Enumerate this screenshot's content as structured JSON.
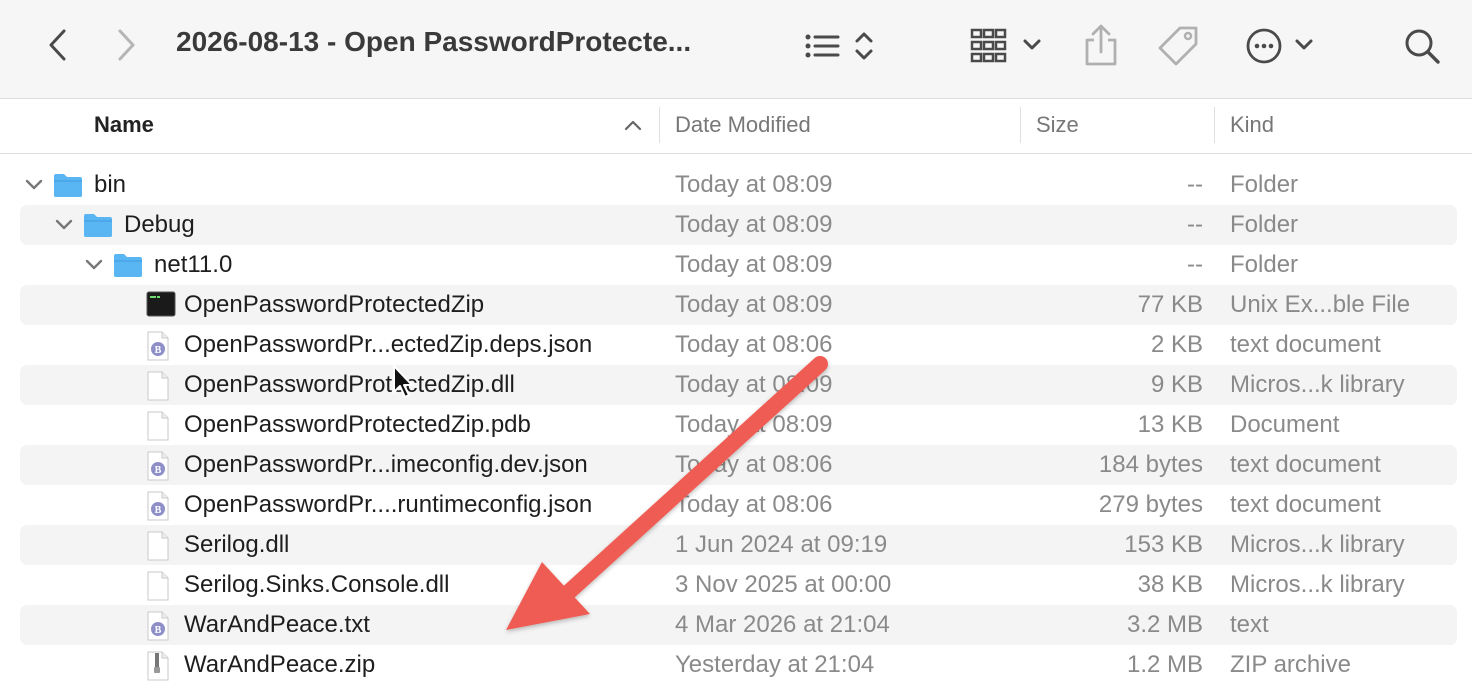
{
  "window": {
    "title": "2026-08-13 - Open PasswordProtecte..."
  },
  "colors": {
    "folder": "#5ab6f2",
    "arrow": "#ef5b52",
    "zebra": "#f4f4f4"
  },
  "columns": {
    "name": "Name",
    "date": "Date Modified",
    "size": "Size",
    "kind": "Kind"
  },
  "rows": [
    {
      "name": "bin",
      "date": "Today at 08:09",
      "size": "--",
      "kind": "Folder",
      "depth": 0,
      "icon": "folder-icon"
    },
    {
      "name": "Debug",
      "date": "Today at 08:09",
      "size": "--",
      "kind": "Folder",
      "depth": 1,
      "icon": "folder-icon"
    },
    {
      "name": "net11.0",
      "date": "Today at 08:09",
      "size": "--",
      "kind": "Folder",
      "depth": 2,
      "icon": "folder-icon"
    },
    {
      "name": "OpenPasswordProtectedZip",
      "date": "Today at 08:09",
      "size": "77 KB",
      "kind": "Unix Ex...ble File",
      "depth": 3,
      "icon": "terminal-icon"
    },
    {
      "name": "OpenPasswordPr...ectedZip.deps.json",
      "date": "Today at 08:06",
      "size": "2 KB",
      "kind": "text document",
      "depth": 3,
      "icon": "text-document-icon"
    },
    {
      "name": "OpenPasswordProtectedZip.dll",
      "date": "Today at 08:09",
      "size": "9 KB",
      "kind": "Micros...k library",
      "depth": 3,
      "icon": "blank-document-icon"
    },
    {
      "name": "OpenPasswordProtectedZip.pdb",
      "date": "Today at 08:09",
      "size": "13 KB",
      "kind": "Document",
      "depth": 3,
      "icon": "blank-document-icon"
    },
    {
      "name": "OpenPasswordPr...imeconfig.dev.json",
      "date": "Today at 08:06",
      "size": "184 bytes",
      "kind": "text document",
      "depth": 3,
      "icon": "text-document-icon"
    },
    {
      "name": "OpenPasswordPr....runtimeconfig.json",
      "date": "Today at 08:06",
      "size": "279 bytes",
      "kind": "text document",
      "depth": 3,
      "icon": "text-document-icon"
    },
    {
      "name": "Serilog.dll",
      "date": "1 Jun 2024 at 09:19",
      "size": "153 KB",
      "kind": "Micros...k library",
      "depth": 3,
      "icon": "blank-document-icon"
    },
    {
      "name": "Serilog.Sinks.Console.dll",
      "date": "3 Nov 2025 at 00:00",
      "size": "38 KB",
      "kind": "Micros...k library",
      "depth": 3,
      "icon": "blank-document-icon"
    },
    {
      "name": "WarAndPeace.txt",
      "date": "4 Mar 2026 at 21:04",
      "size": "3.2 MB",
      "kind": "text",
      "depth": 3,
      "icon": "text-document-icon"
    },
    {
      "name": "WarAndPeace.zip",
      "date": "Yesterday at 21:04",
      "size": "1.2 MB",
      "kind": "ZIP archive",
      "depth": 3,
      "icon": "zip-archive-icon"
    }
  ]
}
